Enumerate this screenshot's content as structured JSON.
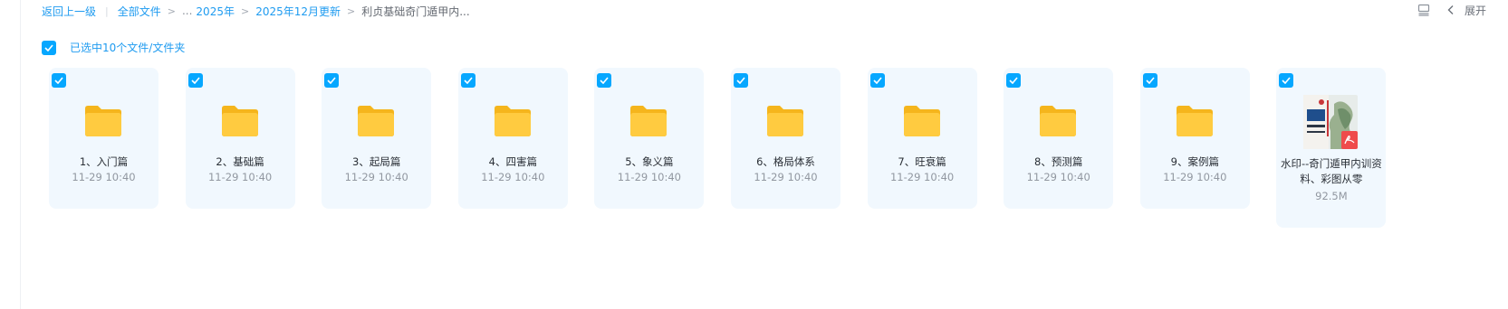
{
  "breadcrumb": {
    "back": "返回上一级",
    "all_files": "全部文件",
    "ellipsis": "...",
    "year": "2025年",
    "month": "2025年12月更新",
    "current": "利贞基础奇门遁甲内..."
  },
  "toolbar": {
    "expand_label": "展开",
    "list_icon": "list-view-icon",
    "collapse_icon": "chevron-left-icon"
  },
  "selection": {
    "label": "已选中10个文件/文件夹"
  },
  "colors": {
    "accent": "#06a7ff",
    "link": "#1e9bf0",
    "card_bg": "#f1f8fe",
    "folder": "#ffc53d"
  },
  "items": [
    {
      "name": "1、入门篇",
      "meta": "11-29 10:40",
      "type": "folder"
    },
    {
      "name": "2、基础篇",
      "meta": "11-29 10:40",
      "type": "folder"
    },
    {
      "name": "3、起局篇",
      "meta": "11-29 10:40",
      "type": "folder"
    },
    {
      "name": "4、四害篇",
      "meta": "11-29 10:40",
      "type": "folder"
    },
    {
      "name": "5、象义篇",
      "meta": "11-29 10:40",
      "type": "folder"
    },
    {
      "name": "6、格局体系",
      "meta": "11-29 10:40",
      "type": "folder"
    },
    {
      "name": "7、旺衰篇",
      "meta": "11-29 10:40",
      "type": "folder"
    },
    {
      "name": "8、预测篇",
      "meta": "11-29 10:40",
      "type": "folder"
    },
    {
      "name": "9、案例篇",
      "meta": "11-29 10:40",
      "type": "folder"
    },
    {
      "name": "水印--奇门遁甲内训资料、彩图从零",
      "meta": "92.5M",
      "type": "pdf"
    }
  ]
}
